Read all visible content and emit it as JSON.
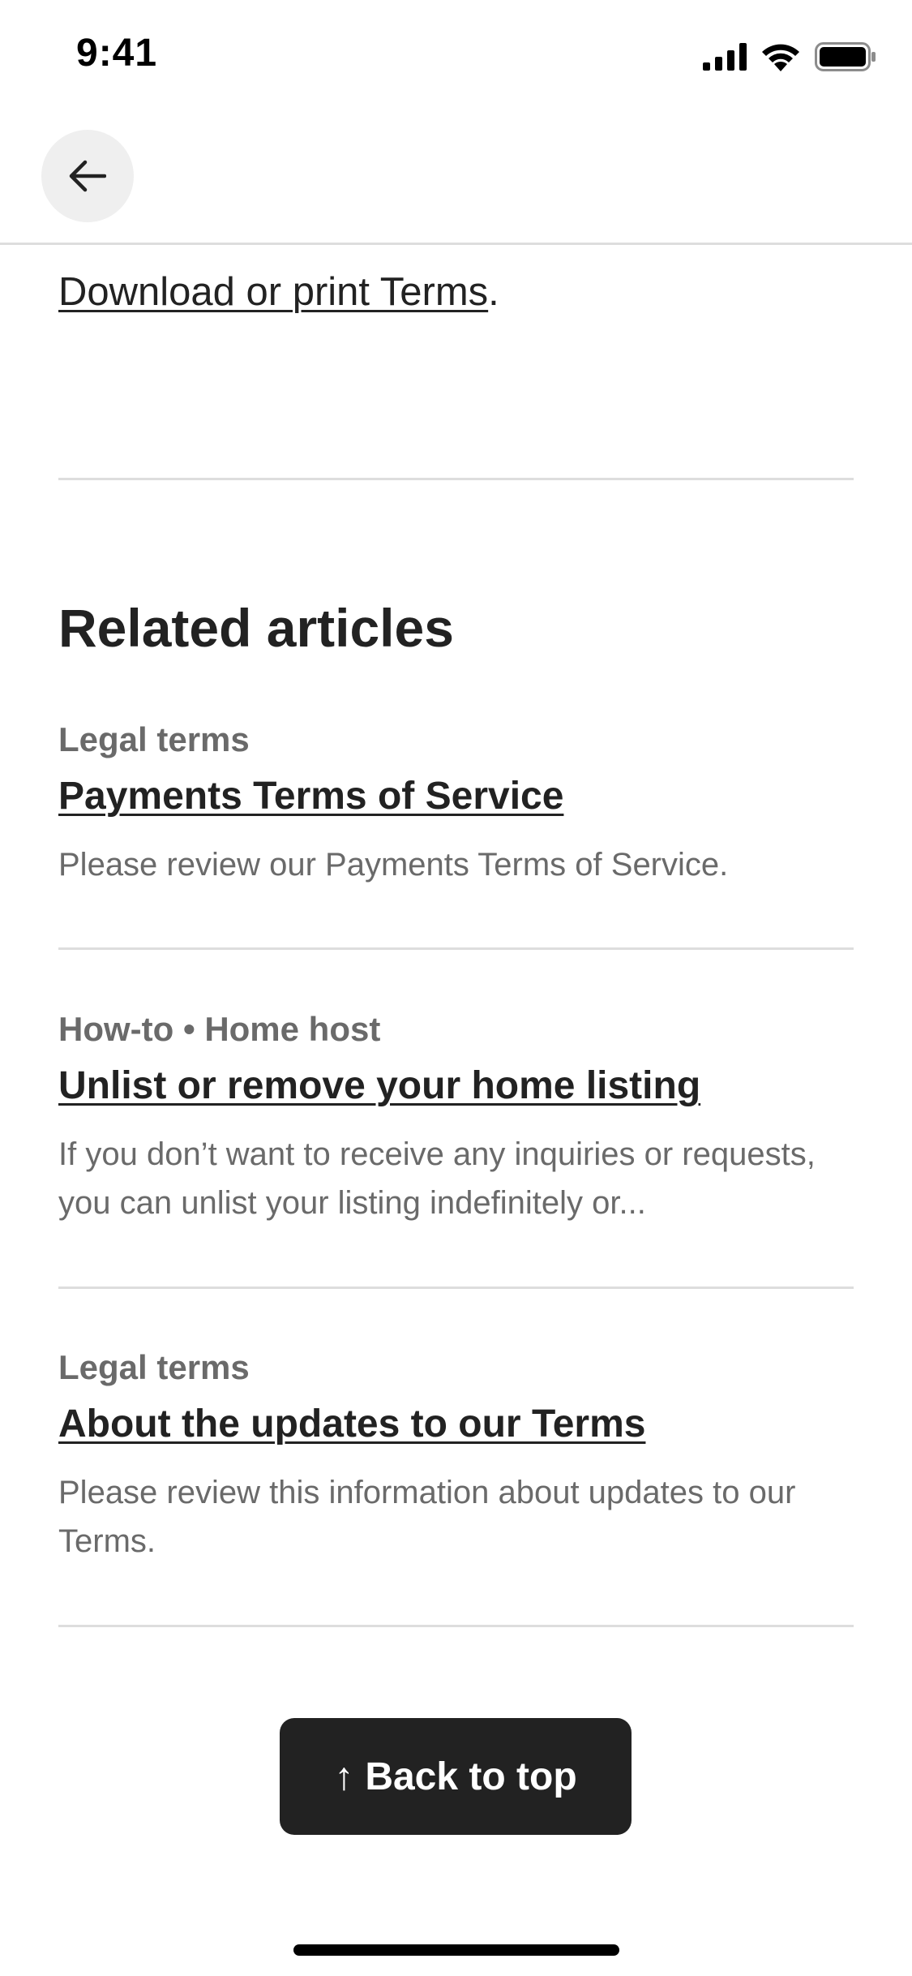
{
  "status_bar": {
    "time": "9:41"
  },
  "nav": {
    "back_icon": "arrow-left-icon"
  },
  "download": {
    "link_text": "Download or print Terms",
    "suffix": "."
  },
  "related": {
    "title": "Related articles",
    "articles": [
      {
        "category": "Legal terms",
        "title": "Payments Terms of Service",
        "description": "Please review our Payments Terms of Service."
      },
      {
        "category": "How-to • Home host",
        "title": "Unlist or remove your home listing",
        "description": "If you don’t want to receive any inquiries or requests, you can unlist your listing indefinitely or..."
      },
      {
        "category": "Legal terms",
        "title": "About the updates to our Terms",
        "description": "Please review this information about updates to our Terms."
      }
    ]
  },
  "back_to_top": {
    "arrow": "↑",
    "label": "Back to top"
  },
  "colors": {
    "primary_text": "#222222",
    "secondary_text": "#6a6a6a",
    "divider": "#dddddd",
    "button_bg": "#222222",
    "back_button_bg": "#efefef"
  }
}
